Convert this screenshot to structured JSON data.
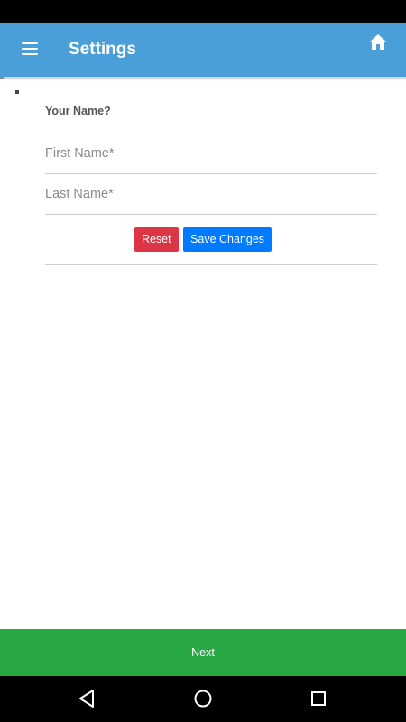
{
  "header": {
    "title": "Settings"
  },
  "form": {
    "section_label": "Your Name?",
    "first_name_placeholder": "First Name*",
    "last_name_placeholder": "Last Name*",
    "first_name_value": "",
    "last_name_value": "",
    "reset_label": "Reset",
    "save_label": "Save Changes"
  },
  "footer": {
    "next_label": "Next"
  },
  "icons": {
    "menu": "menu-icon",
    "home": "home-icon",
    "back": "back-triangle-icon",
    "nav_home": "circle-icon",
    "recents": "square-icon"
  },
  "colors": {
    "app_bar": "#4a9fd8",
    "reset": "#dc3545",
    "save": "#007bff",
    "next": "#28a745"
  }
}
